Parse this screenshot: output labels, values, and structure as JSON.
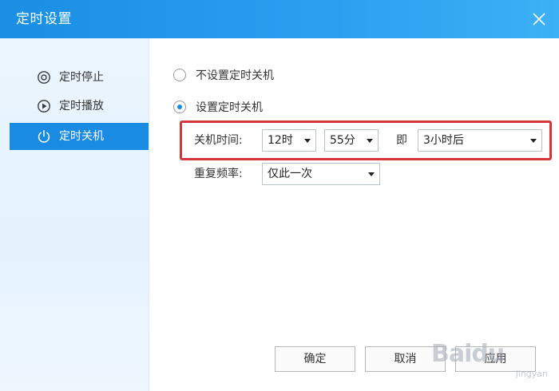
{
  "window": {
    "title": "定时设置",
    "close_icon": "close-icon"
  },
  "sidebar": {
    "items": [
      {
        "label": "定时停止",
        "icon": "timer-stop-icon",
        "active": false
      },
      {
        "label": "定时播放",
        "icon": "timer-play-icon",
        "active": false
      },
      {
        "label": "定时关机",
        "icon": "power-icon",
        "active": true
      }
    ]
  },
  "main": {
    "options": [
      {
        "label": "不设置定时关机",
        "checked": false
      },
      {
        "label": "设置定时关机",
        "checked": true
      }
    ],
    "shutdown_time": {
      "label": "关机时间:",
      "hour": "12时",
      "minute": "55分",
      "separator": "即",
      "relative": "3小时后"
    },
    "repeat": {
      "label": "重复频率:",
      "value": "仅此一次"
    }
  },
  "buttons": {
    "ok": "确定",
    "cancel": "取消",
    "apply": "应用"
  },
  "watermark": {
    "brand": "Baidu",
    "sub": "jingyan"
  },
  "colors": {
    "accent": "#1a8be2",
    "highlight": "#d9343a"
  }
}
